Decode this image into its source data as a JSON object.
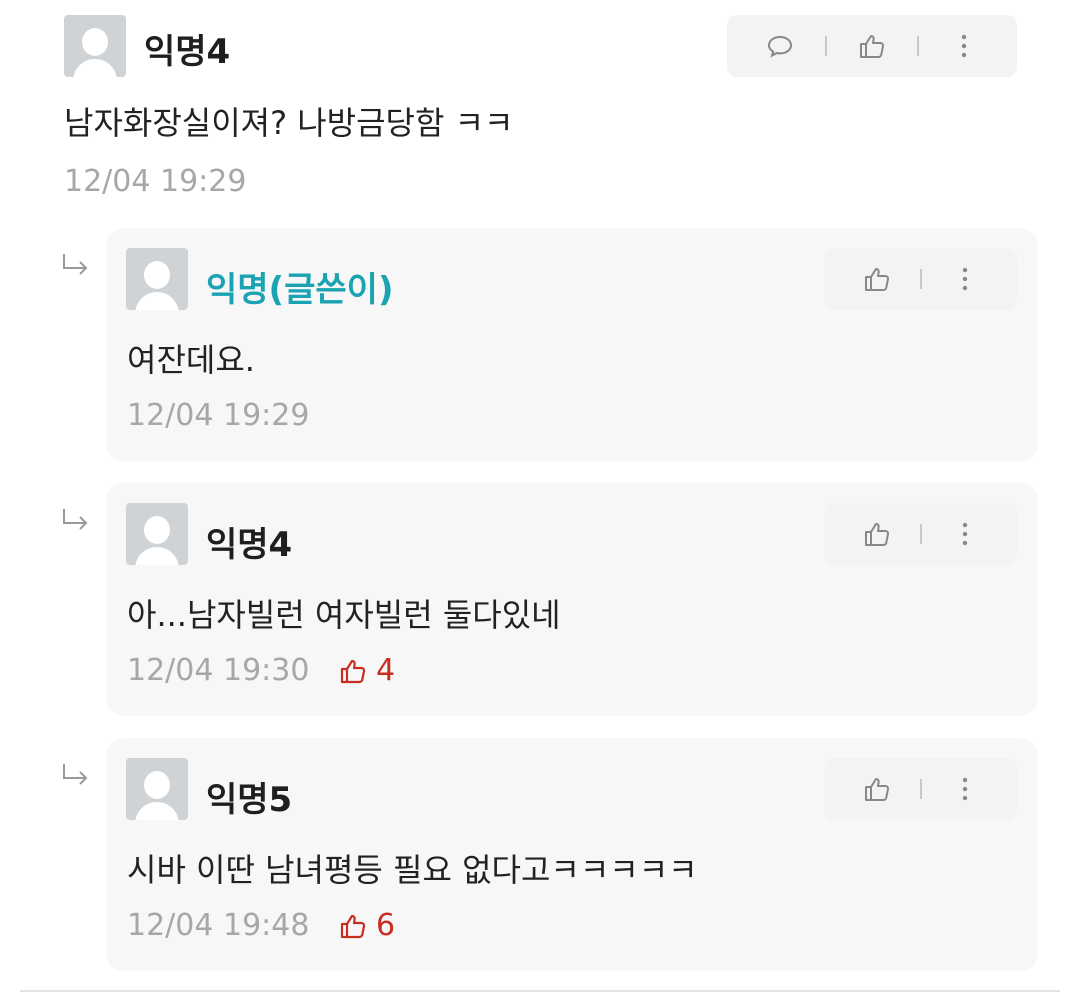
{
  "comments": [
    {
      "name": "익명4",
      "text": "남자화장실이져? 나방금당함 ㅋㅋ",
      "time": "12/04 19:29",
      "likes": ""
    },
    {
      "name": "익명(글쓴이)",
      "text": "여잔데요.",
      "time": "12/04 19:29",
      "likes": ""
    },
    {
      "name": "익명4",
      "text": "아...남자빌런 여자빌런 둘다있네",
      "time": "12/04 19:30",
      "likes": "4"
    },
    {
      "name": "익명5",
      "text": "시바 이딴 남녀평등 필요 없다고ㅋㅋㅋㅋㅋ",
      "time": "12/04 19:48",
      "likes": "6"
    }
  ],
  "colors": {
    "author": "#1aa3b2",
    "like": "#c62e22",
    "muted": "#a7a7a7"
  },
  "icons": {
    "reply": "speech-bubble-icon",
    "like": "thumbs-up-icon",
    "more": "more-vertical-icon",
    "reply_indicator": "reply-arrow-icon"
  }
}
